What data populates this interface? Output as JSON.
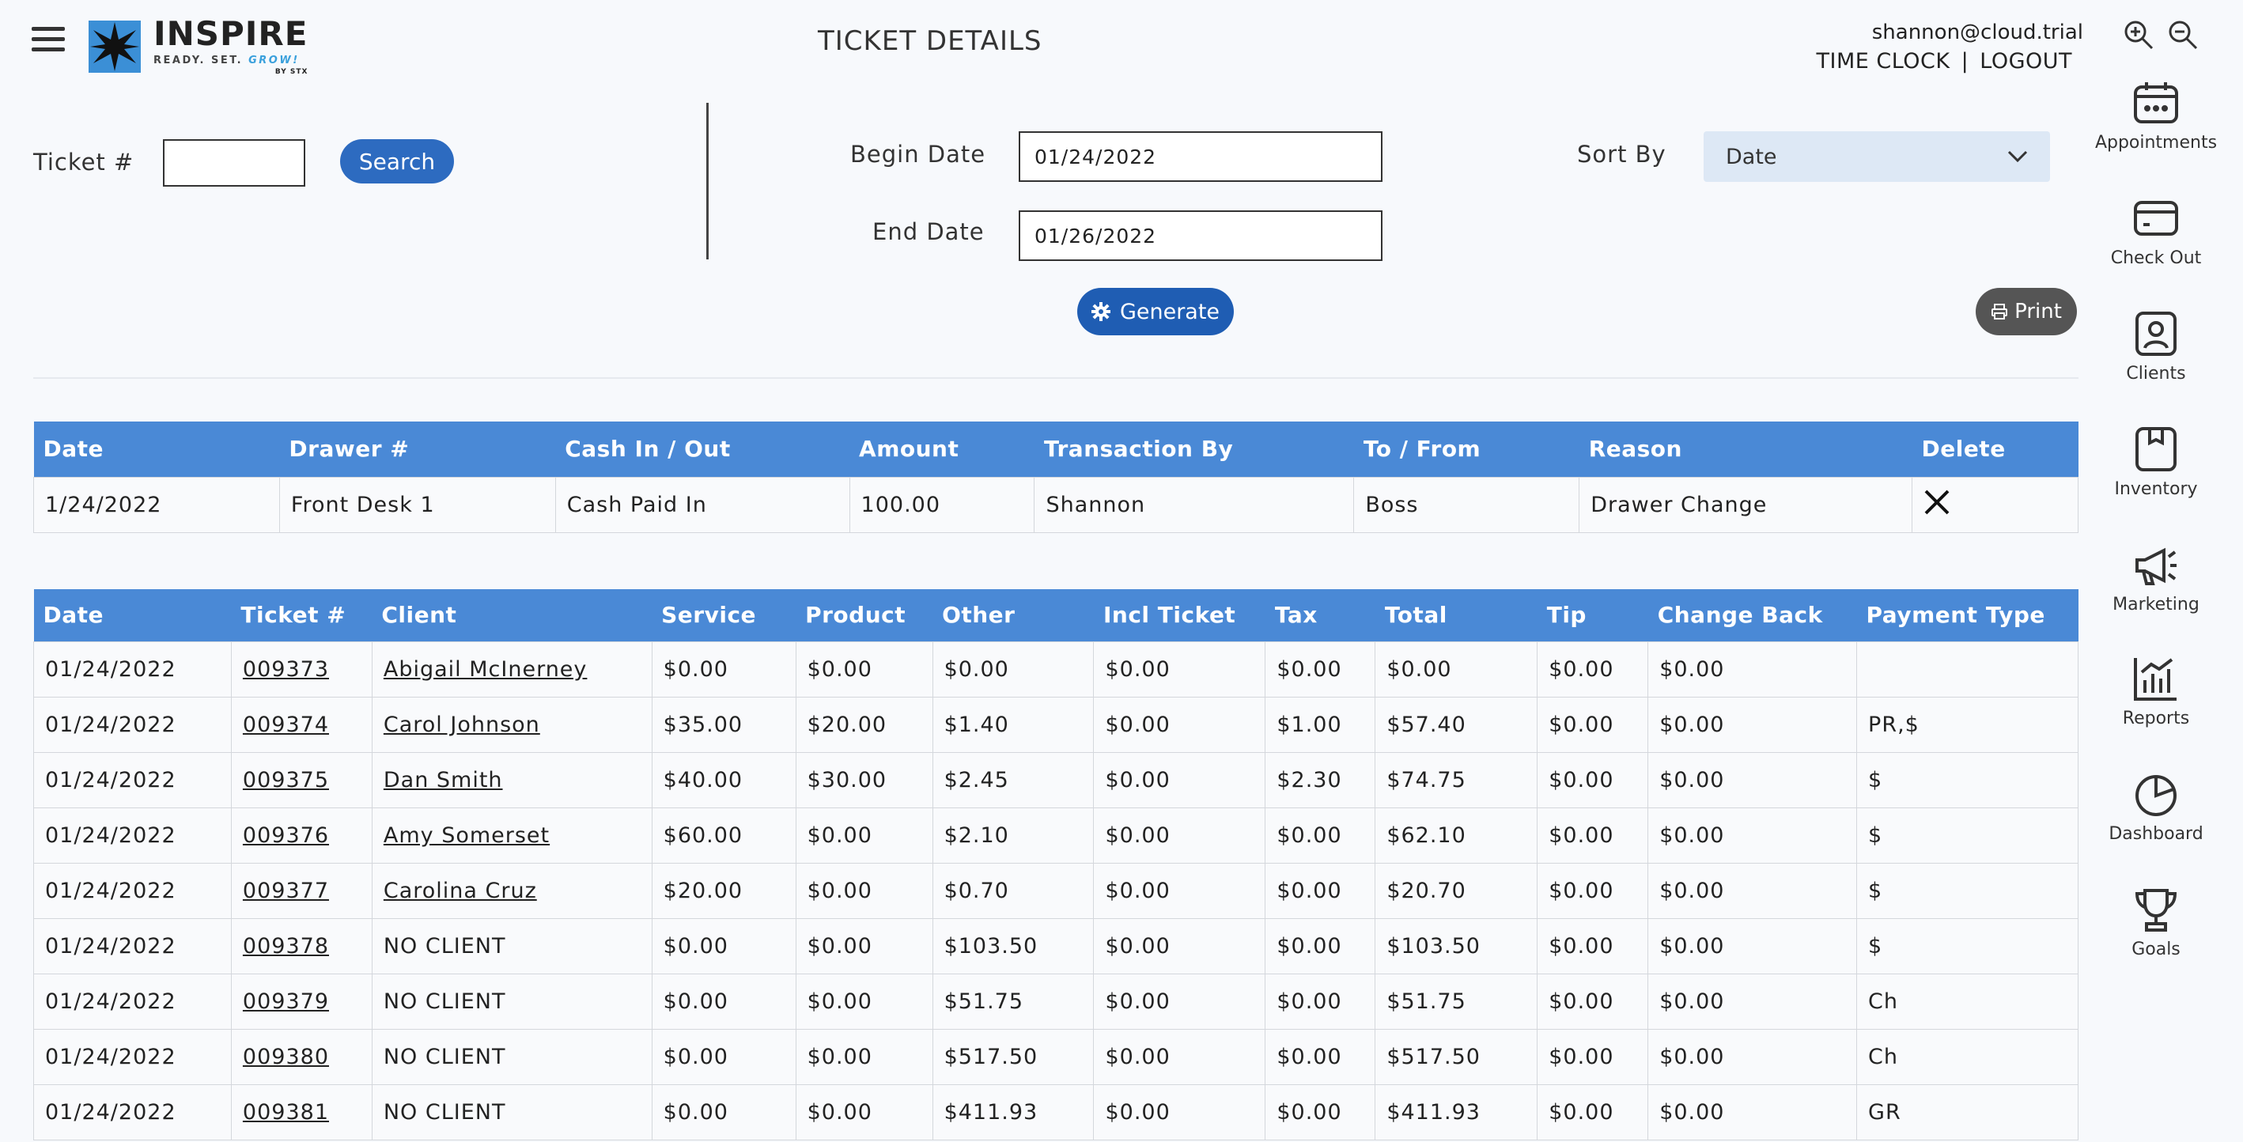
{
  "header": {
    "title": "TICKET  DETAILS",
    "user_email": "shannon@cloud.trial",
    "time_clock": "TIME CLOCK",
    "separator": "|",
    "logout": "LOGOUT"
  },
  "logo": {
    "name": "INSPIRE",
    "tagline": "READY. SET. ",
    "tagline_accent": "GROW!",
    "byline": "BY STX"
  },
  "nav": [
    {
      "label": "Appointments",
      "icon": "calendar-icon"
    },
    {
      "label": "Check Out",
      "icon": "credit-card-icon"
    },
    {
      "label": "Clients",
      "icon": "client-icon"
    },
    {
      "label": "Inventory",
      "icon": "box-icon"
    },
    {
      "label": "Marketing",
      "icon": "megaphone-icon"
    },
    {
      "label": "Reports",
      "icon": "bar-chart-icon"
    },
    {
      "label": "Dashboard",
      "icon": "pie-chart-icon"
    },
    {
      "label": "Goals",
      "icon": "trophy-icon"
    }
  ],
  "search": {
    "ticket_label": "Ticket #",
    "ticket_value": "",
    "search_button": "Search",
    "begin_label": "Begin Date",
    "begin_value": "01/24/2022",
    "end_label": "End Date",
    "end_value": "01/26/2022",
    "sort_label": "Sort By",
    "sort_value": "Date",
    "generate_button": "Generate",
    "print_button": "Print"
  },
  "cash_table": {
    "headers": [
      "Date",
      "Drawer #",
      "Cash In / Out",
      "Amount",
      "Transaction By",
      "To / From",
      "Reason",
      "Delete"
    ],
    "rows": [
      {
        "date": "1/24/2022",
        "drawer": "Front Desk 1",
        "cash_in_out": "Cash Paid In",
        "amount": "100.00",
        "transaction_by": "Shannon",
        "to_from": "Boss",
        "reason": "Drawer Change"
      }
    ]
  },
  "tickets_table": {
    "headers": [
      "Date",
      "Ticket #",
      "Client",
      "Service",
      "Product",
      "Other",
      "Incl Ticket",
      "Tax",
      "Total",
      "Tip",
      "Change Back",
      "Payment Type"
    ],
    "rows": [
      {
        "date": "01/24/2022",
        "ticket": "009373",
        "client": "Abigail McInerney",
        "client_link": true,
        "service": "$0.00",
        "product": "$0.00",
        "other": "$0.00",
        "incl": "$0.00",
        "tax": "$0.00",
        "total": "$0.00",
        "tip": "$0.00",
        "change": "$0.00",
        "payment": ""
      },
      {
        "date": "01/24/2022",
        "ticket": "009374",
        "client": "Carol Johnson",
        "client_link": true,
        "service": "$35.00",
        "product": "$20.00",
        "other": "$1.40",
        "incl": "$0.00",
        "tax": "$1.00",
        "total": "$57.40",
        "tip": "$0.00",
        "change": "$0.00",
        "payment": "PR,$"
      },
      {
        "date": "01/24/2022",
        "ticket": "009375",
        "client": "Dan Smith",
        "client_link": true,
        "service": "$40.00",
        "product": "$30.00",
        "other": "$2.45",
        "incl": "$0.00",
        "tax": "$2.30",
        "total": "$74.75",
        "tip": "$0.00",
        "change": "$0.00",
        "payment": "$"
      },
      {
        "date": "01/24/2022",
        "ticket": "009376",
        "client": "Amy Somerset",
        "client_link": true,
        "service": "$60.00",
        "product": "$0.00",
        "other": "$2.10",
        "incl": "$0.00",
        "tax": "$0.00",
        "total": "$62.10",
        "tip": "$0.00",
        "change": "$0.00",
        "payment": "$"
      },
      {
        "date": "01/24/2022",
        "ticket": "009377",
        "client": "Carolina Cruz",
        "client_link": true,
        "service": "$20.00",
        "product": "$0.00",
        "other": "$0.70",
        "incl": "$0.00",
        "tax": "$0.00",
        "total": "$20.70",
        "tip": "$0.00",
        "change": "$0.00",
        "payment": "$"
      },
      {
        "date": "01/24/2022",
        "ticket": "009378",
        "client": "NO CLIENT",
        "client_link": false,
        "service": "$0.00",
        "product": "$0.00",
        "other": "$103.50",
        "incl": "$0.00",
        "tax": "$0.00",
        "total": "$103.50",
        "tip": "$0.00",
        "change": "$0.00",
        "payment": "$"
      },
      {
        "date": "01/24/2022",
        "ticket": "009379",
        "client": "NO CLIENT",
        "client_link": false,
        "service": "$0.00",
        "product": "$0.00",
        "other": "$51.75",
        "incl": "$0.00",
        "tax": "$0.00",
        "total": "$51.75",
        "tip": "$0.00",
        "change": "$0.00",
        "payment": "Ch"
      },
      {
        "date": "01/24/2022",
        "ticket": "009380",
        "client": "NO CLIENT",
        "client_link": false,
        "service": "$0.00",
        "product": "$0.00",
        "other": "$517.50",
        "incl": "$0.00",
        "tax": "$0.00",
        "total": "$517.50",
        "tip": "$0.00",
        "change": "$0.00",
        "payment": "Ch"
      },
      {
        "date": "01/24/2022",
        "ticket": "009381",
        "client": "NO CLIENT",
        "client_link": false,
        "service": "$0.00",
        "product": "$0.00",
        "other": "$411.93",
        "incl": "$0.00",
        "tax": "$0.00",
        "total": "$411.93",
        "tip": "$0.00",
        "change": "$0.00",
        "payment": "GR"
      }
    ]
  },
  "colors": {
    "header_blue": "#4a89d6",
    "button_blue": "#2d6bc0",
    "print_gray": "#555555",
    "sort_bg": "#dde8f5"
  }
}
